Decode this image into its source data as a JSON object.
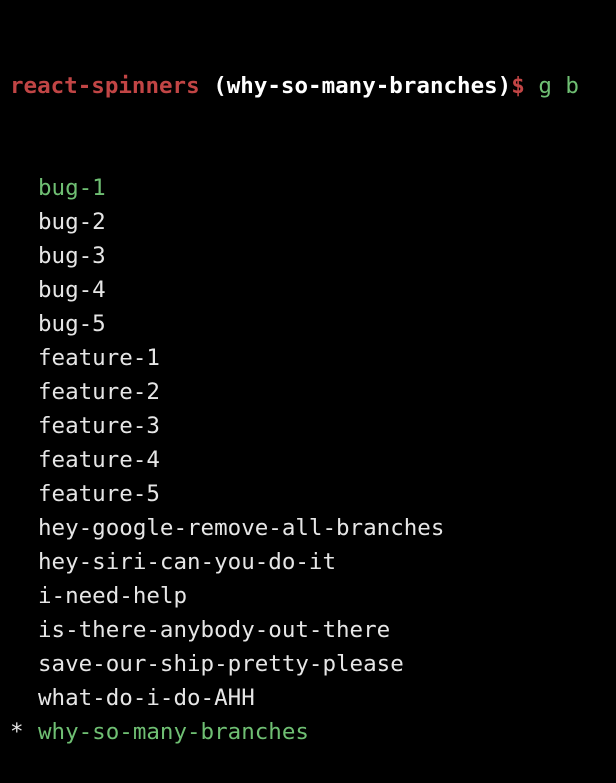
{
  "prompt": {
    "directory": "react-spinners",
    "branch_display": "(why-so-many-branches)",
    "symbol": "$",
    "command": "g b"
  },
  "branches": [
    {
      "marker": "",
      "name": "bug-1",
      "color": "green"
    },
    {
      "marker": "",
      "name": "bug-2",
      "color": "default"
    },
    {
      "marker": "",
      "name": "bug-3",
      "color": "default"
    },
    {
      "marker": "",
      "name": "bug-4",
      "color": "default"
    },
    {
      "marker": "",
      "name": "bug-5",
      "color": "default"
    },
    {
      "marker": "",
      "name": "feature-1",
      "color": "default"
    },
    {
      "marker": "",
      "name": "feature-2",
      "color": "default"
    },
    {
      "marker": "",
      "name": "feature-3",
      "color": "default"
    },
    {
      "marker": "",
      "name": "feature-4",
      "color": "default"
    },
    {
      "marker": "",
      "name": "feature-5",
      "color": "default"
    },
    {
      "marker": "",
      "name": "hey-google-remove-all-branches",
      "color": "default"
    },
    {
      "marker": "",
      "name": "hey-siri-can-you-do-it",
      "color": "default"
    },
    {
      "marker": "",
      "name": "i-need-help",
      "color": "default"
    },
    {
      "marker": "",
      "name": "is-there-anybody-out-there",
      "color": "default"
    },
    {
      "marker": "",
      "name": "save-our-ship-pretty-please",
      "color": "default"
    },
    {
      "marker": "",
      "name": "what-do-i-do-AHH",
      "color": "default"
    },
    {
      "marker": "*",
      "name": "why-so-many-branches",
      "color": "green"
    }
  ],
  "colors": {
    "background": "#000000",
    "prompt_red": "#c14545",
    "green": "#6fbf73",
    "text": "#e6e6e6"
  }
}
